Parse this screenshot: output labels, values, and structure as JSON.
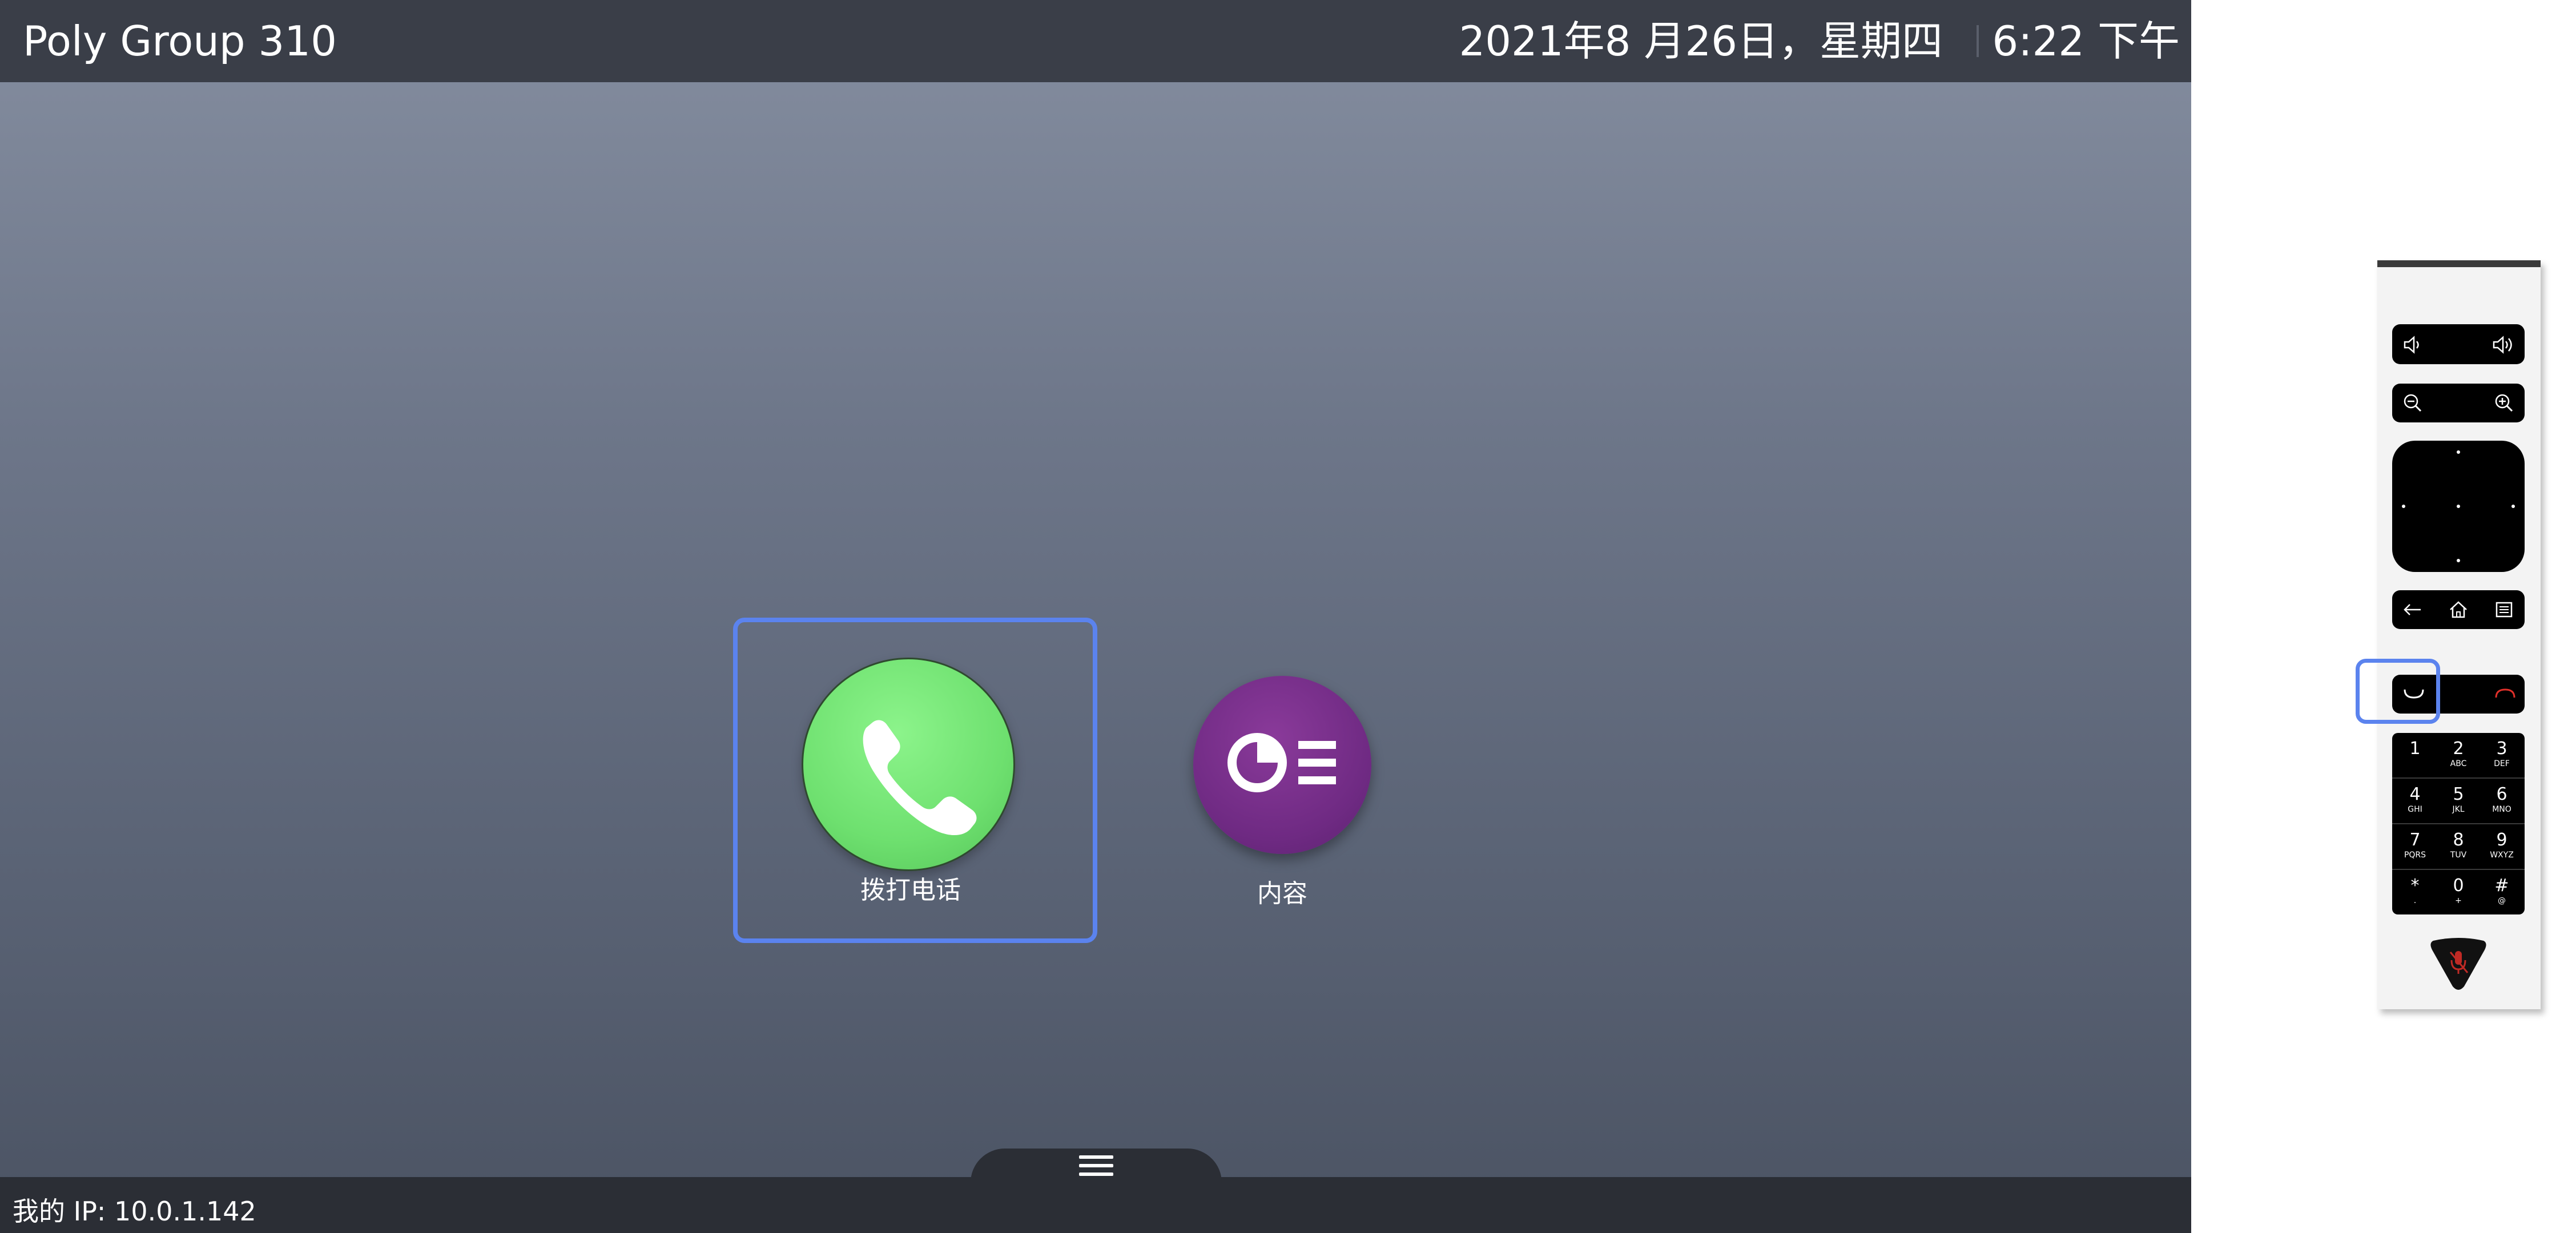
{
  "top_bar": {
    "system_name": "Poly Group 310",
    "date": "2021年8 月26日，星期四",
    "time": "6:22 下午"
  },
  "tiles": {
    "call": {
      "label": "拨打电话",
      "icon": "phone-icon",
      "color": "#6ee06f"
    },
    "content": {
      "label": "内容",
      "icon": "content-share-icon",
      "color": "#6f2a83"
    }
  },
  "bottom_bar": {
    "ip_label": "我的 IP: 10.0.1.142",
    "menu_icon": "hamburger-menu-icon"
  },
  "remote": {
    "buttons": [
      "volume-down",
      "volume-up",
      "zoom-out",
      "zoom-in",
      "navigation-pad",
      "back",
      "home",
      "menu",
      "call",
      "hang-up",
      "mute"
    ],
    "keypad": [
      {
        "digit": "1",
        "letters": ""
      },
      {
        "digit": "2",
        "letters": "ABC"
      },
      {
        "digit": "3",
        "letters": "DEF"
      },
      {
        "digit": "4",
        "letters": "GHI"
      },
      {
        "digit": "5",
        "letters": "JKL"
      },
      {
        "digit": "6",
        "letters": "MNO"
      },
      {
        "digit": "7",
        "letters": "PQRS"
      },
      {
        "digit": "8",
        "letters": "TUV"
      },
      {
        "digit": "9",
        "letters": "WXYZ"
      },
      {
        "digit": "*",
        "letters": "."
      },
      {
        "digit": "0",
        "letters": "+"
      },
      {
        "digit": "#",
        "letters": "@"
      }
    ],
    "accent": "#5b83ee",
    "hangup_color": "#e0302a"
  }
}
